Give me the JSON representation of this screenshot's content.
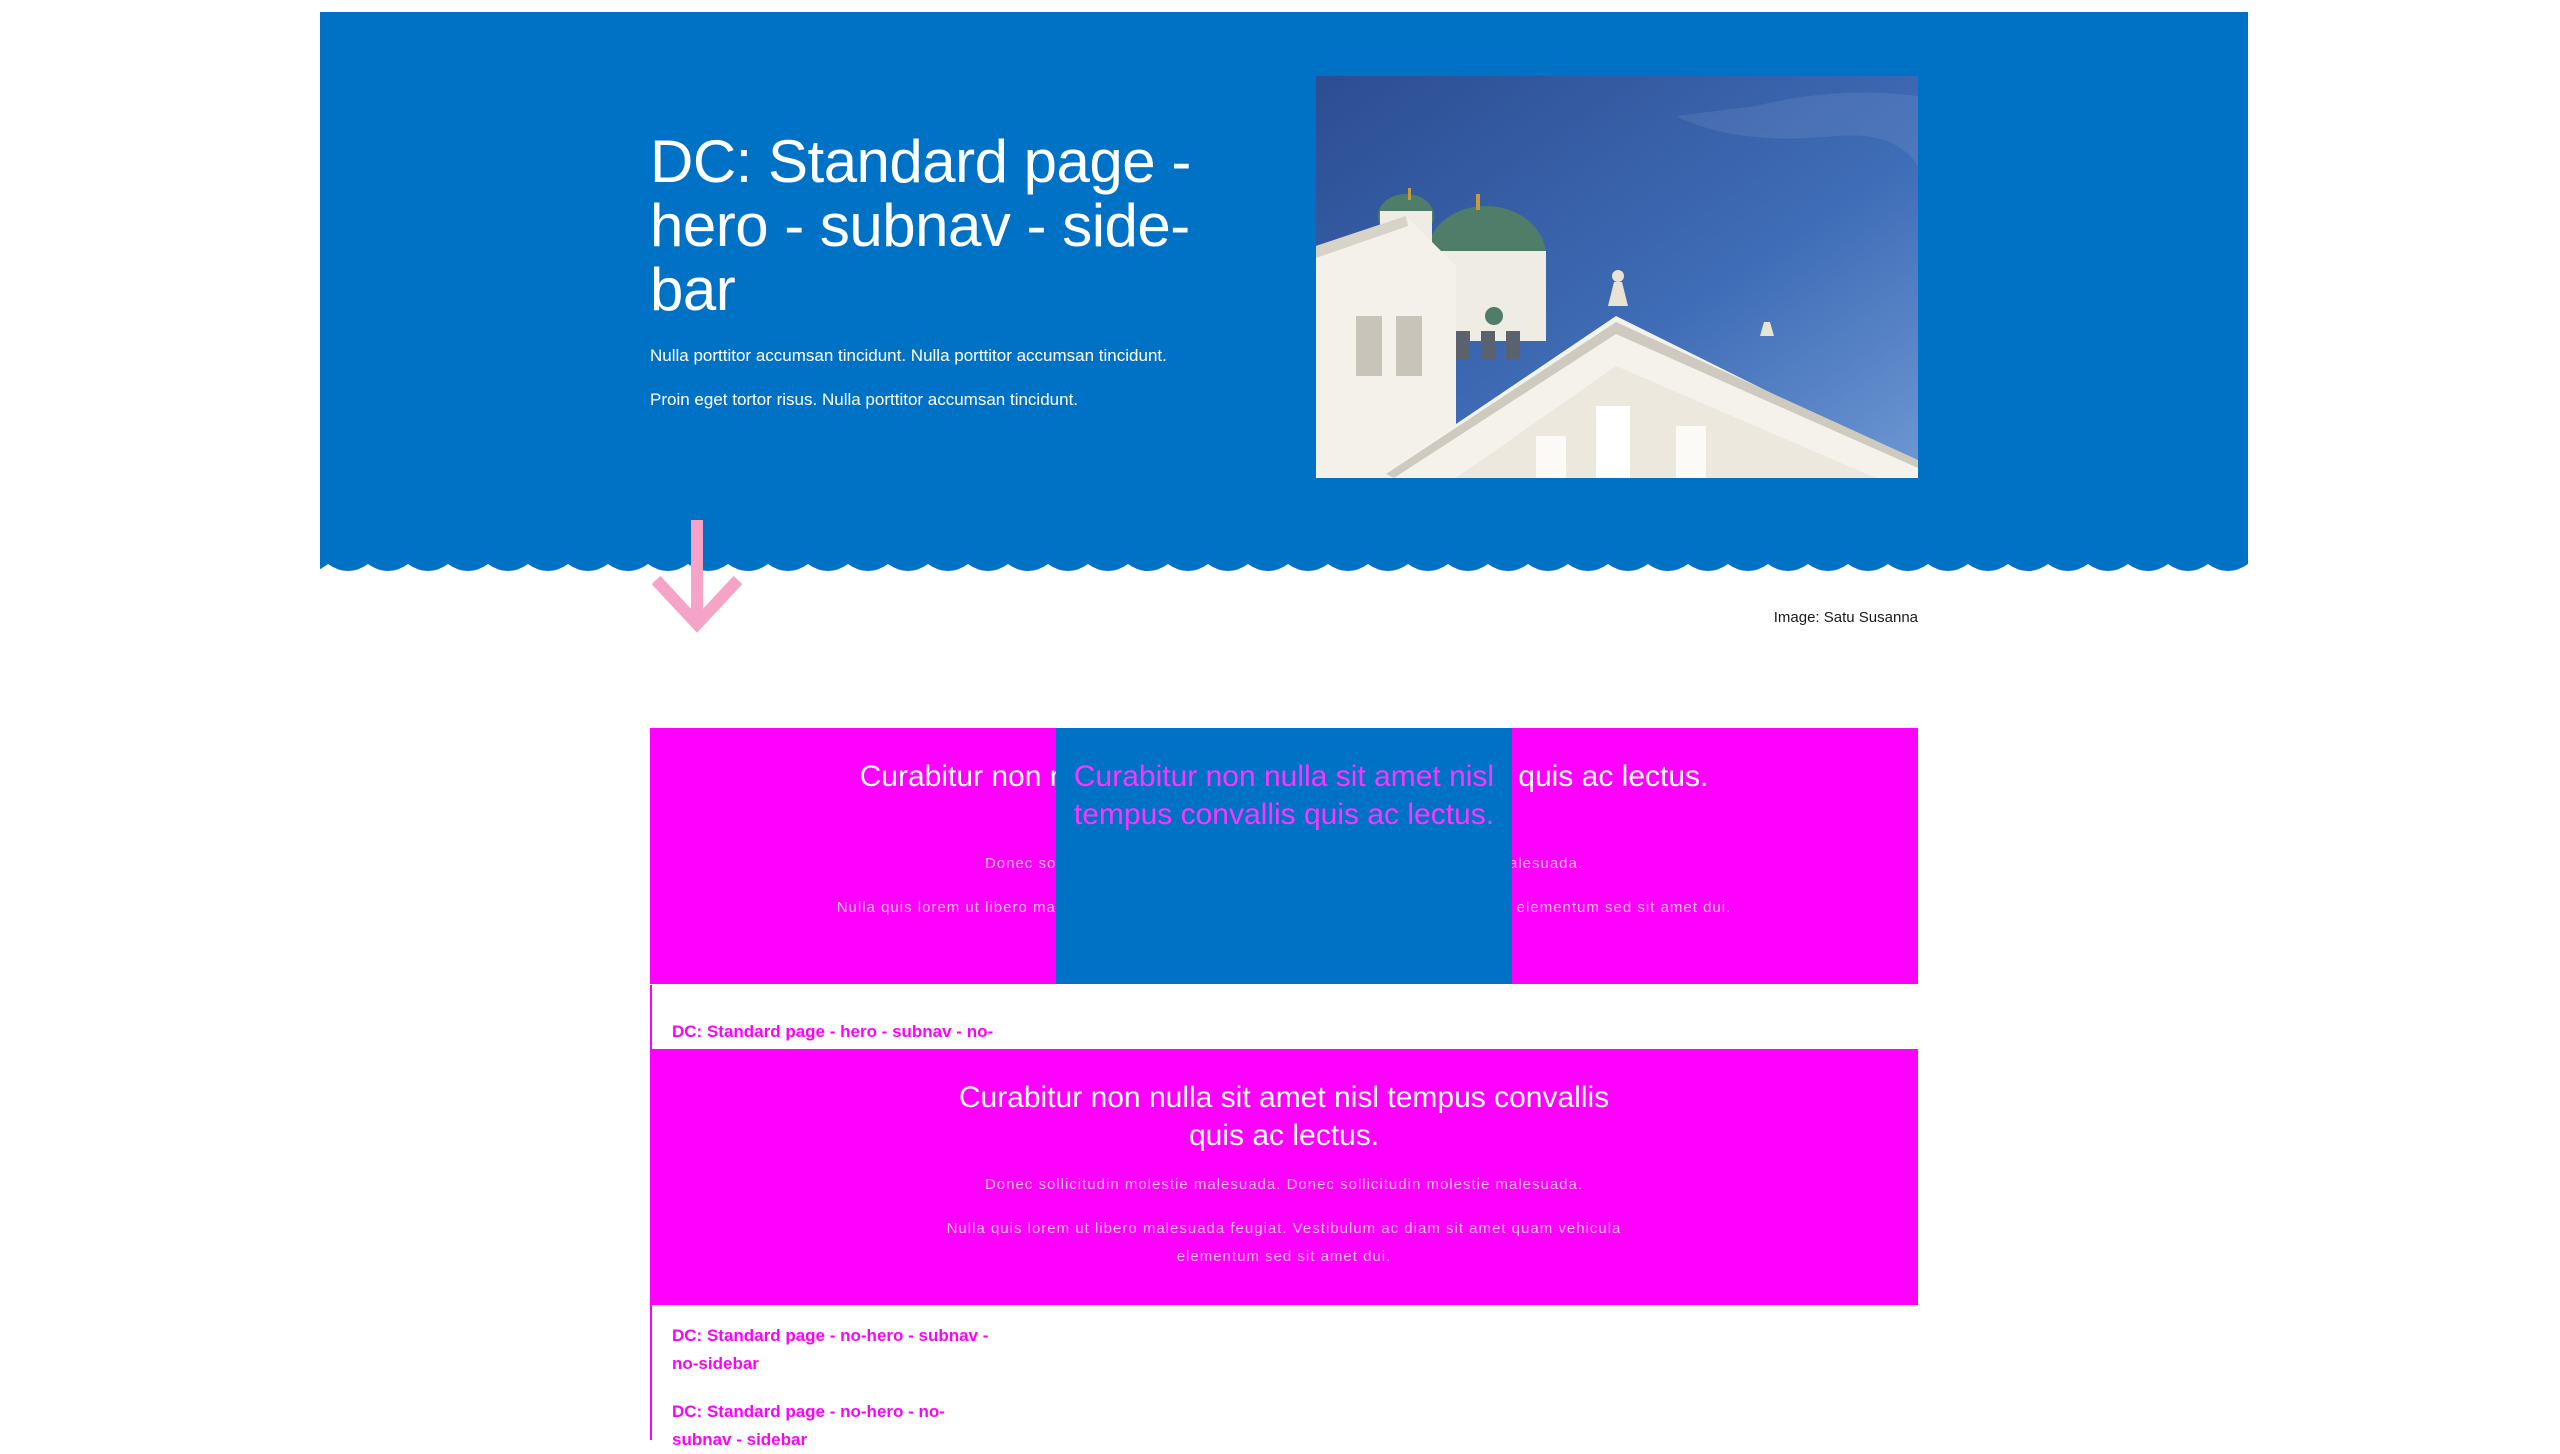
{
  "hero": {
    "title": "DC: Standard page - hero - subnav - side-bar",
    "paragraph_1": "Nulla porttitor accumsan tincidunt. Nulla porttitor accumsan tincidunt.",
    "paragraph_2": "Proin eget tortor risus. Nulla porttitor accumsan tincidunt.",
    "image_credit": "Image: Satu Susanna",
    "colors": {
      "background": "#0072c6",
      "text": "#ffffff",
      "arrow": "#f5a3c7"
    }
  },
  "content_block_1": {
    "title": "Curabitur non nulla sit amet nisl tempus convallis quis ac lectus.",
    "paragraph_1": "Donec sollicitudin molestie malesuada. Donec sollicitudin molestie malesuada.",
    "paragraph_2": "Nulla quis lorem ut libero malesuada feugiat. Vestibulum ac diam sit amet quam vehicula elementum sed sit amet dui."
  },
  "content_block_2": {
    "title": "Curabitur non nulla sit amet nisl tempus convallis quis ac lectus.",
    "paragraph_1": "Donec sollicitudin molestie malesuada. Donec sollicitudin molestie malesuada.",
    "paragraph_2": "Nulla quis lorem ut libero malesuada feugiat. Vestibulum ac diam sit amet quam vehicula elementum sed sit amet dui."
  },
  "sidebar_nav": {
    "partial_link_text": "sidebar",
    "links": [
      "DC: Standard page - hero - subnav - no-",
      "DC: Standard page - no-hero - subnav - no-sidebar",
      "DC: Standard page - no-hero - no-subnav - sidebar"
    ]
  },
  "colors": {
    "accent": "#ff00ff",
    "blue": "#0072c6"
  }
}
